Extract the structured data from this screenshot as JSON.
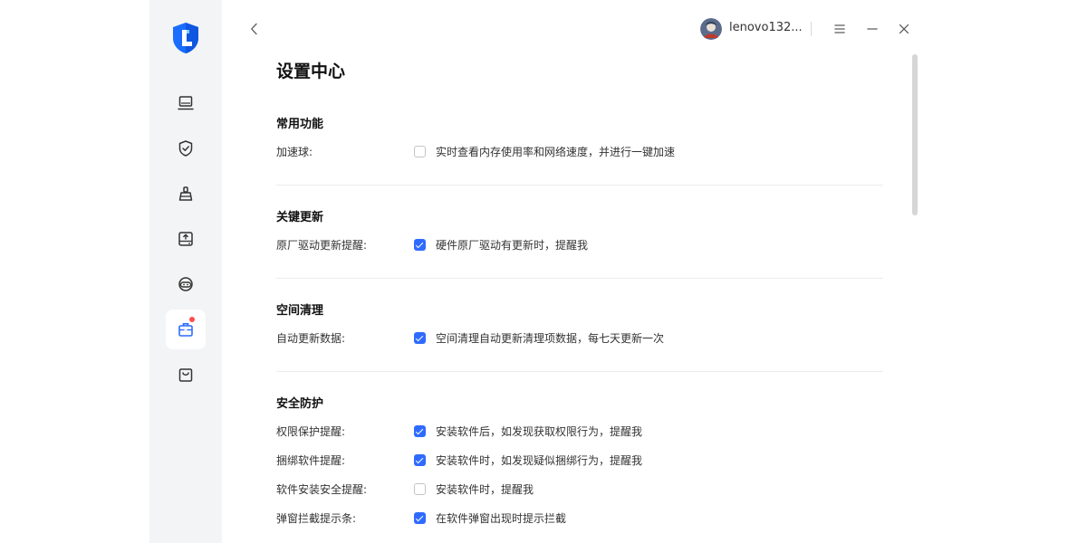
{
  "header": {
    "username": "lenovo132..."
  },
  "page": {
    "title": "设置中心"
  },
  "sections": [
    {
      "title": "常用功能",
      "rows": [
        {
          "label": "加速球:",
          "checked": false,
          "text": "实时查看内存使用率和网络速度，并进行一键加速"
        }
      ]
    },
    {
      "title": "关键更新",
      "rows": [
        {
          "label": "原厂驱动更新提醒:",
          "checked": true,
          "text": "硬件原厂驱动有更新时，提醒我"
        }
      ]
    },
    {
      "title": "空间清理",
      "rows": [
        {
          "label": "自动更新数据:",
          "checked": true,
          "text": "空间清理自动更新清理项数据，每七天更新一次"
        }
      ]
    },
    {
      "title": "安全防护",
      "rows": [
        {
          "label": "权限保护提醒:",
          "checked": true,
          "text": "安装软件后，如发现获取权限行为，提醒我"
        },
        {
          "label": "捆绑软件提醒:",
          "checked": true,
          "text": "安装软件时，如发现疑似捆绑行为，提醒我"
        },
        {
          "label": "软件安装安全提醒:",
          "checked": false,
          "text": "安装软件时，提醒我"
        },
        {
          "label": "弹窗拦截提示条:",
          "checked": true,
          "text": "在软件弹窗出现时提示拦截"
        }
      ]
    }
  ],
  "sidebar": {
    "items": [
      {
        "icon": "laptop-icon",
        "active": false,
        "badge": false
      },
      {
        "icon": "shield-check-icon",
        "active": false,
        "badge": false
      },
      {
        "icon": "broom-icon",
        "active": false,
        "badge": false
      },
      {
        "icon": "drive-upload-icon",
        "active": false,
        "badge": false
      },
      {
        "icon": "headset-icon",
        "active": false,
        "badge": false
      },
      {
        "icon": "toolbox-icon",
        "active": true,
        "badge": true
      },
      {
        "icon": "shopping-bag-icon",
        "active": false,
        "badge": false
      }
    ]
  },
  "colors": {
    "accent": "#2f6bff",
    "sidebar_bg": "#f3f4f6",
    "badge": "#ff4d4f"
  }
}
